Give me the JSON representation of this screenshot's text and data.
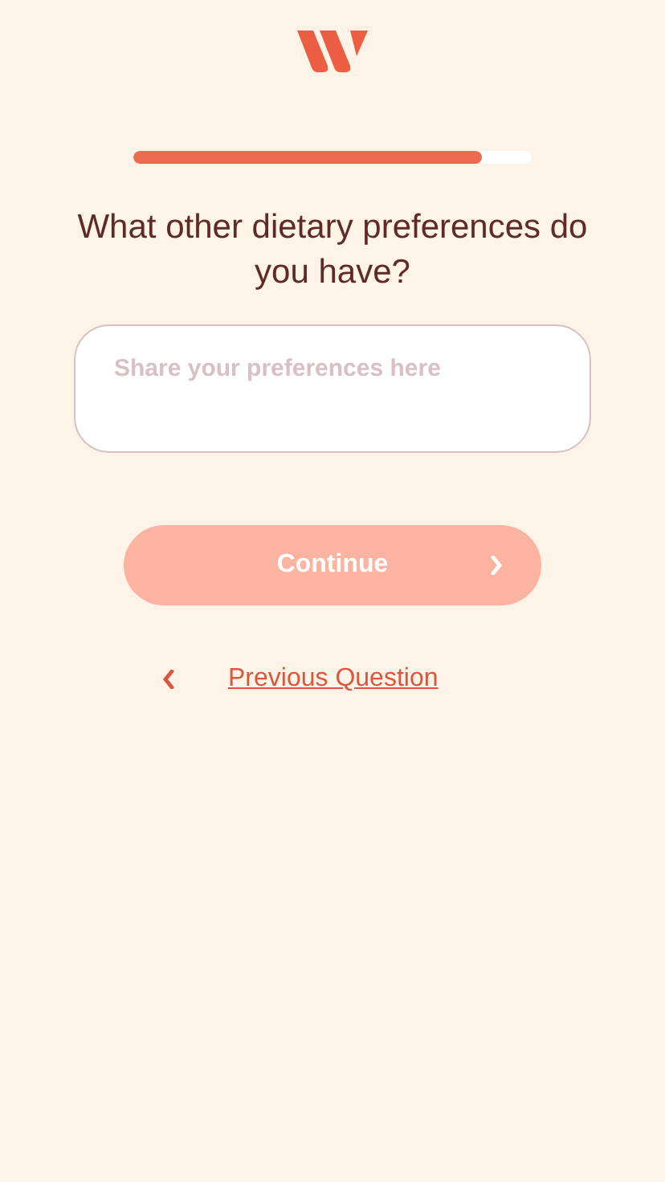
{
  "progress": {
    "level": 0.875
  },
  "question": {
    "title": "What other dietary preferences do you have?"
  },
  "answer": {
    "placeholder": "Share your preferences here"
  },
  "continue_button": {
    "label": "Continue",
    "disabled": true
  },
  "previous_link": {
    "label": "Previous Question"
  }
}
